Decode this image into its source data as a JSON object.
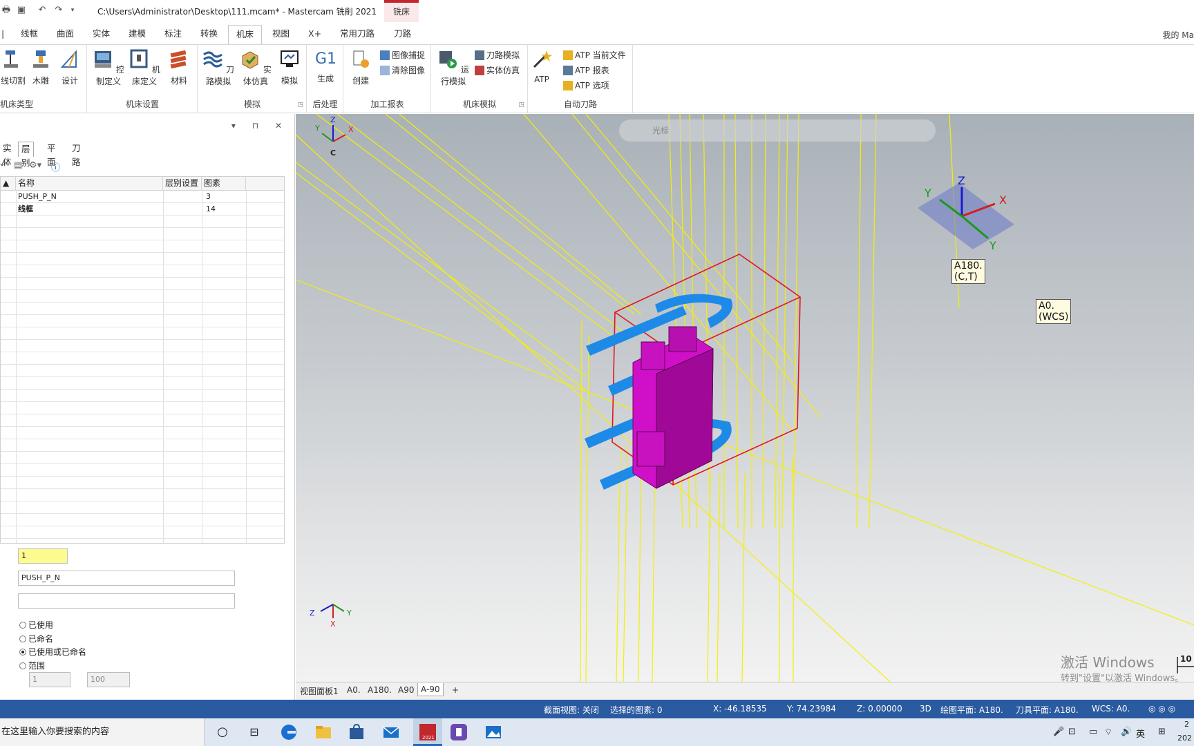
{
  "titlebar": {
    "title": "C:\\Users\\Administrator\\Desktop\\111.mcam* - Mastercam 铣削 2021",
    "context_tab": "铣床"
  },
  "ribbon_tabs": [
    "线框",
    "曲面",
    "实体",
    "建模",
    "标注",
    "转换",
    "机床",
    "视图",
    "X+",
    "常用刀路",
    "刀路"
  ],
  "ribbon_tab_active": "机床",
  "ribbon_right": "我的 Ma",
  "ribbon": {
    "group_machine_type": {
      "label": "机床类型",
      "buttons": [
        "线切割",
        "木雕",
        "设计"
      ]
    },
    "group_machine_setup": {
      "label": "机床设置",
      "buttons": [
        "控制定义",
        "机床定义",
        "材料"
      ]
    },
    "group_simulate": {
      "label": "模拟",
      "buttons": [
        "刀路模拟",
        "实体仿真",
        "模拟"
      ]
    },
    "group_post": {
      "label": "后处理",
      "buttons": [
        "生成"
      ],
      "g1": "G1"
    },
    "group_report": {
      "label": "加工报表",
      "buttons": [
        "创建"
      ],
      "small": [
        "图像捕捉",
        "清除图像"
      ]
    },
    "group_machine_sim": {
      "label": "机床模拟",
      "buttons": [
        "运行模拟"
      ],
      "small": [
        "刀路模拟",
        "实体仿真"
      ]
    },
    "group_atp": {
      "label": "自动刀路",
      "buttons": [
        "ATP"
      ],
      "small": [
        "ATP 当前文件",
        "ATP 报表",
        "ATP 选项"
      ]
    }
  },
  "panel": {
    "tabs": [
      "实体",
      "层别",
      "平面",
      "刀路"
    ],
    "active_tab": "层别",
    "columns": [
      "名称",
      "层别设置",
      "图素"
    ],
    "rows": [
      {
        "name": "PUSH_P_N",
        "setting": "",
        "count": "3"
      },
      {
        "name": "线框",
        "setting": "",
        "count": "14"
      }
    ],
    "level_number": "1",
    "level_name": "PUSH_P_N",
    "level_set": "",
    "radios": [
      "已使用",
      "已命名",
      "已使用或已命名",
      "范围"
    ],
    "radio_selected": "已使用或已命名",
    "range_from": "1",
    "range_to": "100"
  },
  "viewport": {
    "toolbar_label": "光标",
    "gnomon_labels": {
      "y": "Y",
      "z": "Z",
      "x": "X",
      "c": "C"
    },
    "tag_ct": "A180.\n(C,T)",
    "tag_wcs": "A0.\n(WCS)",
    "watermark_title": "激活 Windows",
    "watermark_sub": "转到\"设置\"以激活 Windows。",
    "scale_label": "10",
    "colors": {
      "wire": "#f4f000",
      "box": "#e01818",
      "part": "#d010c8",
      "fixture": "#1e8ae8"
    }
  },
  "viewsheets": [
    "视图面板1",
    "A0.",
    "A180.",
    "A90",
    "A-90",
    "+"
  ],
  "viewsheet_active": "A-90",
  "status": {
    "section_view": "截面视图: 关闭",
    "selected": "选择的图素: 0",
    "x": "X:  -46.18535",
    "y": "Y:  74.23984",
    "z": "Z:  0.00000",
    "mode": "3D",
    "cplane": "绘图平面: A180.",
    "tplane": "刀具平面: A180.",
    "wcs": "WCS: A0."
  },
  "taskbar": {
    "search_placeholder": "在这里输入你要搜索的内容",
    "ime": "英",
    "clock_top": "2",
    "clock_bottom": "202"
  }
}
